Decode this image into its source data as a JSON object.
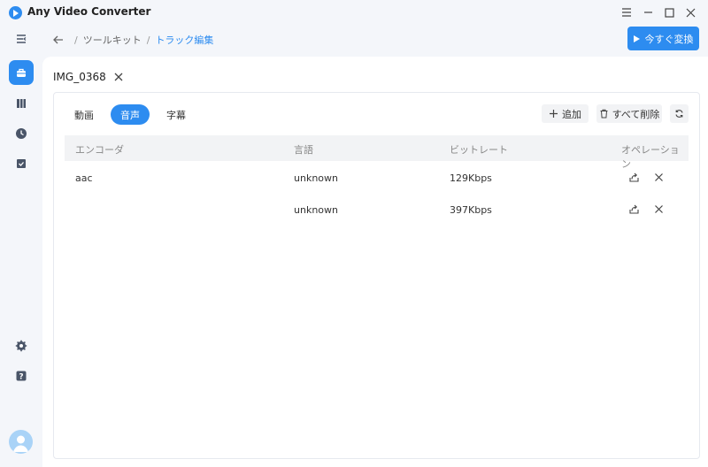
{
  "app": {
    "title": "Any Video Converter"
  },
  "breadcrumb": {
    "items": [
      "ツールキット",
      "トラック編集"
    ]
  },
  "actions": {
    "convert_label": "今すぐ変換"
  },
  "file": {
    "name": "IMG_0368"
  },
  "tabs": [
    {
      "label": "動画",
      "active": false
    },
    {
      "label": "音声",
      "active": true
    },
    {
      "label": "字幕",
      "active": false
    }
  ],
  "toolbar": {
    "add_label": "追加",
    "delete_all_label": "すべて削除"
  },
  "table": {
    "headers": [
      "エンコーダ",
      "言語",
      "ビットレート",
      "オペレーション"
    ],
    "rows": [
      {
        "encoder": "aac",
        "language": "unknown",
        "bitrate": "129Kbps"
      },
      {
        "encoder": "",
        "language": "unknown",
        "bitrate": "397Kbps"
      }
    ]
  },
  "colors": {
    "accent": "#2d8cf0",
    "rail_icon": "#4a5568"
  },
  "icons": {
    "rail": [
      "collapse-menu-icon",
      "toolbox-icon",
      "library-icon",
      "history-icon",
      "tasks-icon",
      "settings-icon",
      "help-icon",
      "user-avatar-icon"
    ],
    "row_ops": [
      "export-icon",
      "delete-icon"
    ]
  }
}
